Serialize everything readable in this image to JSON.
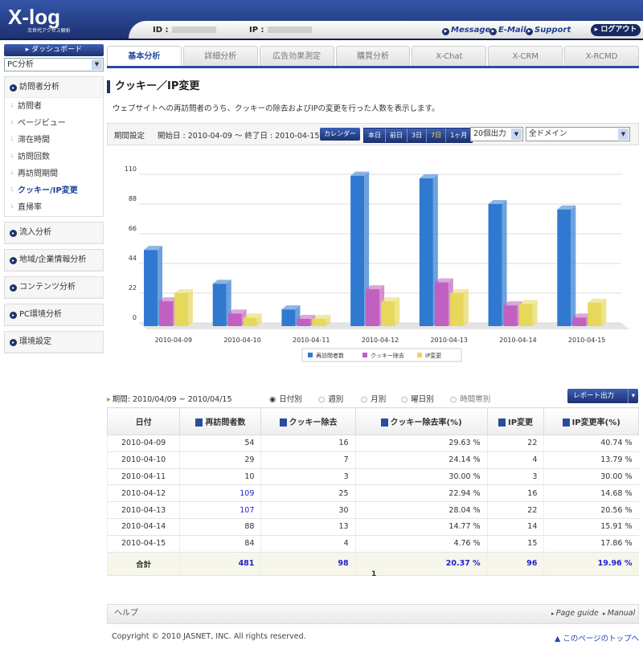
{
  "header": {
    "logo": "X-log",
    "logo_sub": "次世代アクセス解析",
    "id_label": "ID :",
    "ip_label": "IP :",
    "links": [
      "Message",
      "E-Mail",
      "Support"
    ],
    "logout": "▸ ログアウト"
  },
  "sidebar": {
    "dashboard": "▸ ダッシュボード",
    "select": "PC分析",
    "groups": [
      {
        "label": "訪問者分析",
        "items": [
          "訪問者",
          "ページビュー",
          "滞在時間",
          "訪問回数",
          "再訪問期間",
          "クッキー/IP変更",
          "直帰率"
        ]
      },
      {
        "label": "流入分析"
      },
      {
        "label": "地域/企業情報分析"
      },
      {
        "label": "コンテンツ分析"
      },
      {
        "label": "PC環境分析"
      },
      {
        "label": "環境設定"
      }
    ],
    "active": "クッキー/IP変更"
  },
  "tabs": [
    "基本分析",
    "詳細分析",
    "広告効果測定",
    "購買分析",
    "X-Chat",
    "X-CRM",
    "X-RCMD"
  ],
  "page": {
    "title": "クッキー／IP変更",
    "description": "ウェブサイトへの再訪問者のうち、クッキーの除去およびIPの変更を行った人数を表示します。"
  },
  "filter": {
    "label": "期間設定",
    "range": "開始日 : 2010-04-09 ～ 終了日 : 2010-04-15",
    "calendar": "カレンダー",
    "quick": [
      "本日",
      "前日",
      "3日",
      "7日",
      "1ヶ月"
    ],
    "output": "20個出力",
    "domain": "全ドメイン"
  },
  "chart_data": {
    "type": "bar",
    "categories": [
      "2010-04-09",
      "2010-04-10",
      "2010-04-11",
      "2010-04-12",
      "2010-04-13",
      "2010-04-14",
      "2010-04-15"
    ],
    "series": [
      {
        "name": "再訪問者数",
        "color": "#2f7ad0",
        "values": [
          54,
          29,
          10,
          109,
          107,
          88,
          84
        ]
      },
      {
        "name": "クッキー除去",
        "color": "#c060c0",
        "values": [
          16,
          7,
          3,
          25,
          30,
          13,
          4
        ]
      },
      {
        "name": "IP変更",
        "color": "#e6d85a",
        "values": [
          22,
          4,
          3,
          16,
          22,
          14,
          15
        ]
      }
    ],
    "yticks": [
      "0",
      "22",
      "44",
      "66",
      "88",
      "110"
    ],
    "ylim": [
      0,
      110
    ],
    "legend": "bottom"
  },
  "report": {
    "period": "期間: 2010/04/09 ~ 2010/04/15",
    "radios": [
      "日付別",
      "週別",
      "月別",
      "曜日別",
      "時間帯別"
    ],
    "export": "レポート出力"
  },
  "table": {
    "headers": [
      "日付",
      "再訪問者数",
      "クッキー除去",
      "クッキー除去率(%)",
      "IP変更",
      "IP変更率(%)"
    ],
    "rows": [
      [
        "2010-04-09",
        "54",
        "16",
        "29.63 %",
        "22",
        "40.74 %"
      ],
      [
        "2010-04-10",
        "29",
        "7",
        "24.14 %",
        "4",
        "13.79 %"
      ],
      [
        "2010-04-11",
        "10",
        "3",
        "30.00 %",
        "3",
        "30.00 %"
      ],
      [
        "2010-04-12",
        "109",
        "25",
        "22.94 %",
        "16",
        "14.68 %"
      ],
      [
        "2010-04-13",
        "107",
        "30",
        "28.04 %",
        "22",
        "20.56 %"
      ],
      [
        "2010-04-14",
        "88",
        "13",
        "14.77 %",
        "14",
        "15.91 %"
      ],
      [
        "2010-04-15",
        "84",
        "4",
        "4.76 %",
        "15",
        "17.86 %"
      ]
    ],
    "total": [
      "合計",
      "481",
      "98",
      "20.37 %",
      "96",
      "19.96 %"
    ]
  },
  "pagination": "1",
  "footer": {
    "help": "ヘルプ",
    "page_guide": "Page guide",
    "manual": "Manual",
    "copyright": "Copyright © 2010 JASNET, INC. All rights reserved.",
    "to_top": "▲ このページのトップへ"
  }
}
